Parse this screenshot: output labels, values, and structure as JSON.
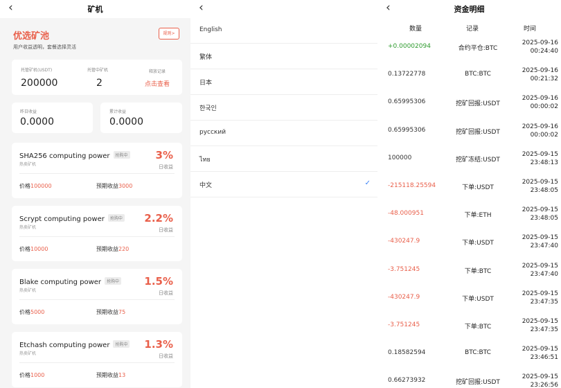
{
  "pool_page": {
    "title": "矿机",
    "back_icon": "chevron-left-icon",
    "heading": "优选矿池",
    "subheading": "用户收益透明，套餐选择灵活",
    "rule_button": "规则>",
    "stats": {
      "hosted_label": "托管矿机(USDT)",
      "hosted_value": "200000",
      "hosting_label": "托管中矿机",
      "hosting_value": "2",
      "records_label": "释放记录",
      "records_link": "点击查看",
      "yesterday_label": "昨日收益",
      "yesterday_value": "0.0000",
      "total_label": "累计收益",
      "total_value": "0.0000"
    },
    "miners": [
      {
        "name": "SHA256 computing power",
        "badge": "抢购中",
        "sub": "热卖矿机",
        "rate": "3%",
        "rate_label": "日收益",
        "price_label": "价格",
        "price": "100000",
        "expected_label": "预期收益",
        "expected": "3000"
      },
      {
        "name": "Scrypt computing power",
        "badge": "抢购中",
        "sub": "热卖矿机",
        "rate": "2.2%",
        "rate_label": "日收益",
        "price_label": "价格",
        "price": "10000",
        "expected_label": "预期收益",
        "expected": "220"
      },
      {
        "name": "Blake computing power",
        "badge": "抢购中",
        "sub": "热卖矿机",
        "rate": "1.5%",
        "rate_label": "日收益",
        "price_label": "价格",
        "price": "5000",
        "expected_label": "预期收益",
        "expected": "75"
      },
      {
        "name": "Etchash computing power",
        "badge": "抢购中",
        "sub": "热卖矿机",
        "rate": "1.3%",
        "rate_label": "日收益",
        "price_label": "价格",
        "price": "1000",
        "expected_label": "预期收益",
        "expected": "13"
      }
    ]
  },
  "language_page": {
    "back_icon": "chevron-left-icon",
    "languages": [
      {
        "label": "English",
        "selected": false
      },
      {
        "label": "繁体",
        "selected": false
      },
      {
        "label": "日本",
        "selected": false
      },
      {
        "label": "한국인",
        "selected": false
      },
      {
        "label": "русский",
        "selected": false
      },
      {
        "label": "ไทย",
        "selected": false
      },
      {
        "label": "中文",
        "selected": true
      }
    ],
    "check_icon": "checkmark-icon",
    "check_glyph": "✓"
  },
  "funds_page": {
    "title": "资金明细",
    "back_icon": "chevron-left-icon",
    "columns": {
      "amount": "数量",
      "record": "记录",
      "time": "时间"
    },
    "rows": [
      {
        "amount": "+0.00002094",
        "record": "合约平仓:BTC",
        "date": "2025-09-16",
        "time": "00:24:40",
        "tone": "pos"
      },
      {
        "amount": "0.13722778",
        "record": "BTC:BTC",
        "date": "2025-09-16",
        "time": "00:21:32",
        "tone": "neu"
      },
      {
        "amount": "0.65995306",
        "record": "挖矿回报:USDT",
        "date": "2025-09-16",
        "time": "00:00:02",
        "tone": "neu"
      },
      {
        "amount": "0.65995306",
        "record": "挖矿回报:USDT",
        "date": "2025-09-16",
        "time": "00:00:02",
        "tone": "neu"
      },
      {
        "amount": "100000",
        "record": "挖矿冻结:USDT",
        "date": "2025-09-15",
        "time": "23:48:13",
        "tone": "neu"
      },
      {
        "amount": "-215118.25594",
        "record": "下单:USDT",
        "date": "2025-09-15",
        "time": "23:48:05",
        "tone": "neg"
      },
      {
        "amount": "-48.000951",
        "record": "下单:ETH",
        "date": "2025-09-15",
        "time": "23:48:05",
        "tone": "neg"
      },
      {
        "amount": "-430247.9",
        "record": "下单:USDT",
        "date": "2025-09-15",
        "time": "23:47:40",
        "tone": "neg"
      },
      {
        "amount": "-3.751245",
        "record": "下单:BTC",
        "date": "2025-09-15",
        "time": "23:47:40",
        "tone": "neg"
      },
      {
        "amount": "-430247.9",
        "record": "下单:USDT",
        "date": "2025-09-15",
        "time": "23:47:35",
        "tone": "neg"
      },
      {
        "amount": "-3.751245",
        "record": "下单:BTC",
        "date": "2025-09-15",
        "time": "23:47:35",
        "tone": "neg"
      },
      {
        "amount": "0.18582594",
        "record": "BTC:BTC",
        "date": "2025-09-15",
        "time": "23:46:51",
        "tone": "neu"
      },
      {
        "amount": "0.66273932",
        "record": "挖矿回报:USDT",
        "date": "2025-09-15",
        "time": "23:26:56",
        "tone": "neu"
      }
    ]
  },
  "colors": {
    "accent": "#e95f4a",
    "positive": "#2e9b2e",
    "check": "#3b82f6"
  }
}
